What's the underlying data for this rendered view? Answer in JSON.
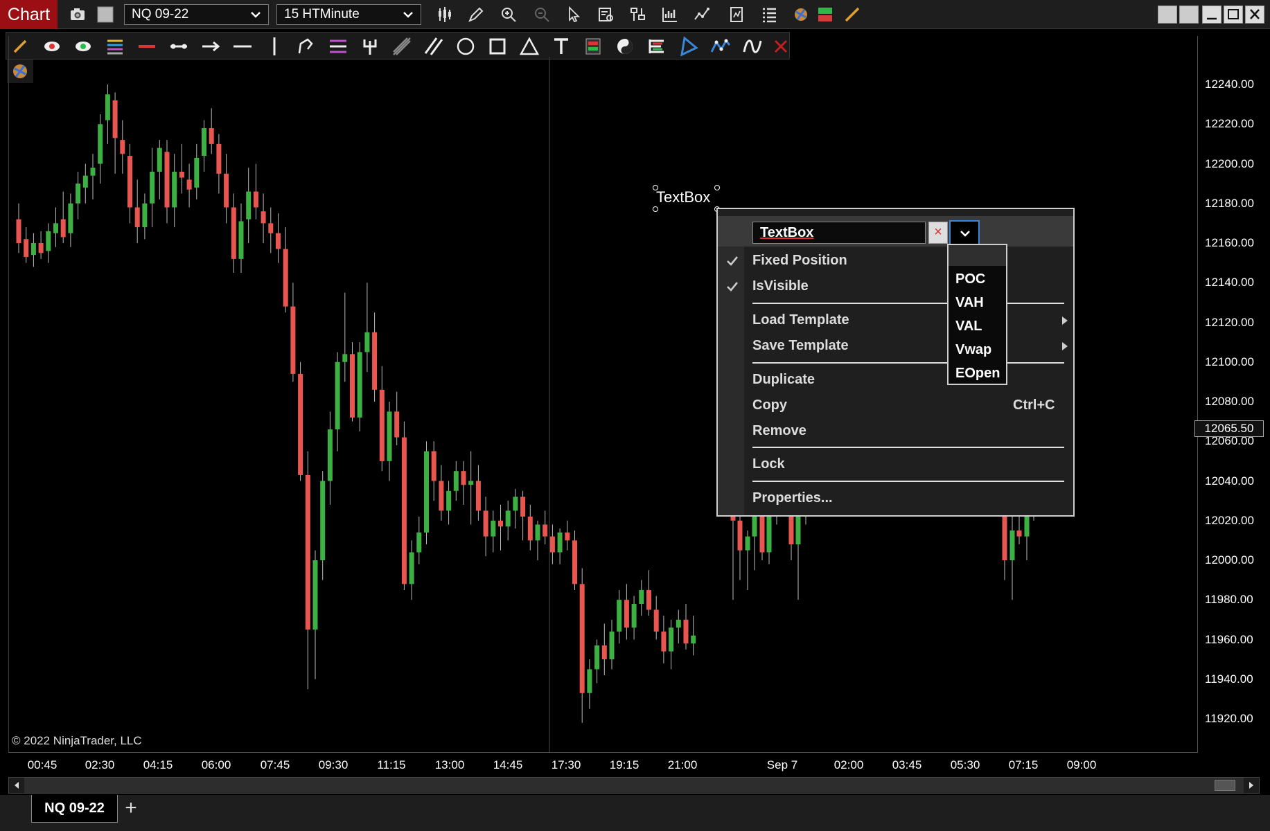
{
  "app": {
    "title": "Chart"
  },
  "toolbar": {
    "instrument": "NQ 09-22",
    "interval": "15 HTMinute"
  },
  "chart": {
    "copyright": "© 2022 NinjaTrader, LLC",
    "price_ticks": [
      "12240.00",
      "12220.00",
      "12200.00",
      "12180.00",
      "12160.00",
      "12140.00",
      "12120.00",
      "12100.00",
      "12080.00",
      "12060.00",
      "12040.00",
      "12020.00",
      "12000.00",
      "11980.00",
      "11960.00",
      "11940.00",
      "11920.00"
    ],
    "last_price": "12065.50",
    "time_ticks": [
      "00:45",
      "02:30",
      "04:15",
      "06:00",
      "07:45",
      "09:30",
      "11:15",
      "13:00",
      "14:45",
      "17:30",
      "19:15",
      "21:00",
      "Sep 7",
      "02:00",
      "03:45",
      "05:30",
      "07:15",
      "09:00"
    ]
  },
  "chart_data": {
    "type": "candlestick",
    "xlabel": "",
    "ylabel": "",
    "ylim": [
      11905,
      12262
    ],
    "candles": [
      [
        12172,
        12180,
        12155,
        12160
      ],
      [
        12162,
        12168,
        12150,
        12153
      ],
      [
        12154,
        12165,
        12148,
        12160
      ],
      [
        12160,
        12166,
        12152,
        12155
      ],
      [
        12156,
        12170,
        12150,
        12166
      ],
      [
        12165,
        12178,
        12158,
        12170
      ],
      [
        12172,
        12186,
        12160,
        12163
      ],
      [
        12165,
        12185,
        12158,
        12180
      ],
      [
        12180,
        12196,
        12172,
        12190
      ],
      [
        12188,
        12200,
        12180,
        12194
      ],
      [
        12194,
        12205,
        12182,
        12198
      ],
      [
        12200,
        12225,
        12190,
        12220
      ],
      [
        12222,
        12240,
        12210,
        12235
      ],
      [
        12232,
        12236,
        12195,
        12213
      ],
      [
        12212,
        12222,
        12195,
        12205
      ],
      [
        12204,
        12210,
        12170,
        12178
      ],
      [
        12178,
        12192,
        12160,
        12168
      ],
      [
        12168,
        12185,
        12162,
        12180
      ],
      [
        12180,
        12208,
        12168,
        12196
      ],
      [
        12196,
        12212,
        12182,
        12208
      ],
      [
        12206,
        12212,
        12170,
        12178
      ],
      [
        12178,
        12205,
        12168,
        12196
      ],
      [
        12196,
        12210,
        12185,
        12193
      ],
      [
        12192,
        12200,
        12178,
        12187
      ],
      [
        12188,
        12210,
        12182,
        12203
      ],
      [
        12204,
        12222,
        12196,
        12218
      ],
      [
        12218,
        12228,
        12205,
        12210
      ],
      [
        12210,
        12215,
        12185,
        12195
      ],
      [
        12195,
        12205,
        12170,
        12178
      ],
      [
        12178,
        12185,
        12145,
        12152
      ],
      [
        12152,
        12180,
        12145,
        12171
      ],
      [
        12172,
        12198,
        12160,
        12186
      ],
      [
        12186,
        12200,
        12172,
        12178
      ],
      [
        12176,
        12185,
        12160,
        12170
      ],
      [
        12170,
        12178,
        12155,
        12165
      ],
      [
        12165,
        12175,
        12150,
        12157
      ],
      [
        12157,
        12168,
        12125,
        12128
      ],
      [
        12128,
        12140,
        12090,
        12094
      ],
      [
        12094,
        12100,
        12040,
        12043
      ],
      [
        12043,
        12055,
        11935,
        11965
      ],
      [
        11965,
        12005,
        11940,
        12000
      ],
      [
        12000,
        12045,
        11990,
        12040
      ],
      [
        12040,
        12075,
        12028,
        12066
      ],
      [
        12066,
        12105,
        12055,
        12100
      ],
      [
        12100,
        12135,
        12090,
        12104
      ],
      [
        12104,
        12110,
        12070,
        12072
      ],
      [
        12072,
        12110,
        12065,
        12105
      ],
      [
        12105,
        12140,
        12095,
        12115
      ],
      [
        12115,
        12125,
        12080,
        12086
      ],
      [
        12086,
        12098,
        12045,
        12050
      ],
      [
        12050,
        12080,
        12040,
        12075
      ],
      [
        12075,
        12085,
        12058,
        12062
      ],
      [
        12062,
        12070,
        11985,
        11988
      ],
      [
        11988,
        12010,
        11980,
        12004
      ],
      [
        12004,
        12022,
        11998,
        12014
      ],
      [
        12014,
        12060,
        12008,
        12055
      ],
      [
        12055,
        12060,
        12030,
        12040
      ],
      [
        12040,
        12048,
        12020,
        12025
      ],
      [
        12025,
        12040,
        12018,
        12035
      ],
      [
        12035,
        12050,
        12030,
        12045
      ],
      [
        12045,
        12050,
        12028,
        12038
      ],
      [
        12038,
        12055,
        12018,
        12040
      ],
      [
        12040,
        12048,
        12020,
        12025
      ],
      [
        12025,
        12032,
        12002,
        12012
      ],
      [
        12012,
        12025,
        12004,
        12020
      ],
      [
        12020,
        12028,
        12005,
        12017
      ],
      [
        12017,
        12030,
        12010,
        12025
      ],
      [
        12025,
        12036,
        12016,
        12032
      ],
      [
        12032,
        12035,
        12010,
        12022
      ],
      [
        12022,
        12028,
        12005,
        12010
      ],
      [
        12010,
        12020,
        12000,
        12018
      ],
      [
        12018,
        12025,
        12008,
        12012
      ],
      [
        12012,
        12018,
        11998,
        12004
      ],
      [
        12004,
        12016,
        11998,
        12014
      ],
      [
        12014,
        12020,
        12005,
        12010
      ],
      [
        12010,
        12015,
        11985,
        11988
      ],
      [
        11988,
        11996,
        11918,
        11933
      ],
      [
        11933,
        11950,
        11925,
        11945
      ],
      [
        11945,
        11960,
        11938,
        11957
      ],
      [
        11957,
        11968,
        11942,
        11950
      ],
      [
        11950,
        11970,
        11945,
        11964
      ],
      [
        11964,
        11985,
        11958,
        11980
      ],
      [
        11980,
        11988,
        11960,
        11966
      ],
      [
        11966,
        11982,
        11960,
        11978
      ],
      [
        11978,
        11990,
        11972,
        11985
      ],
      [
        11985,
        11995,
        11972,
        11975
      ],
      [
        11975,
        11982,
        11960,
        11964
      ],
      [
        11964,
        11972,
        11948,
        11954
      ],
      [
        11954,
        11970,
        11945,
        11966
      ],
      [
        11966,
        11975,
        11958,
        11970
      ],
      [
        11970,
        11978,
        11955,
        11958
      ],
      [
        11958,
        11972,
        11952,
        11962
      ]
    ],
    "right_candles": [
      [
        12040,
        12050,
        11980,
        12020
      ],
      [
        12020,
        12030,
        11990,
        12005
      ],
      [
        12005,
        12015,
        11985,
        12012
      ],
      [
        12012,
        12025,
        11995,
        12022
      ],
      [
        12022,
        12030,
        12000,
        12004
      ],
      [
        12004,
        12035,
        11998,
        12028
      ],
      [
        12028,
        12045,
        12018,
        12040
      ],
      [
        12040,
        12052,
        12030,
        12035
      ],
      [
        12035,
        12042,
        12000,
        12008
      ],
      [
        12008,
        12025,
        11980,
        12022
      ],
      [
        12022,
        12038,
        12018,
        12035
      ],
      [
        12030,
        12050,
        11990,
        12000
      ],
      [
        12000,
        12022,
        11980,
        12015
      ],
      [
        12015,
        12030,
        12008,
        12012
      ],
      [
        12012,
        12035,
        12000,
        12028
      ],
      [
        12028,
        12080,
        12020,
        12075
      ],
      [
        12075,
        12112,
        12068,
        12100
      ],
      [
        12100,
        12105,
        12070,
        12086
      ],
      [
        12086,
        12092,
        12040,
        12046
      ],
      [
        12046,
        12072,
        12040,
        12068
      ],
      [
        12068,
        12078,
        12058,
        12065
      ]
    ]
  },
  "textbox": {
    "label": "TextBox"
  },
  "context_menu": {
    "name_value": "TextBox",
    "clear_label": "×",
    "items": {
      "fixed_position": "Fixed Position",
      "is_visible": "IsVisible",
      "load_template": "Load Template",
      "save_template": "Save Template",
      "duplicate": "Duplicate",
      "copy": "Copy",
      "copy_shortcut": "Ctrl+C",
      "remove": "Remove",
      "lock": "Lock",
      "properties": "Properties..."
    }
  },
  "dropdown": {
    "options": [
      "POC",
      "VAH",
      "VAL",
      "Vwap",
      "EOpen"
    ]
  },
  "tabs": {
    "active": "NQ 09-22",
    "add_label": "+"
  },
  "colors": {
    "up": "#3cb043",
    "down": "#e8564f",
    "title_bg": "#9b0f14",
    "accent": "#3a86d8"
  }
}
